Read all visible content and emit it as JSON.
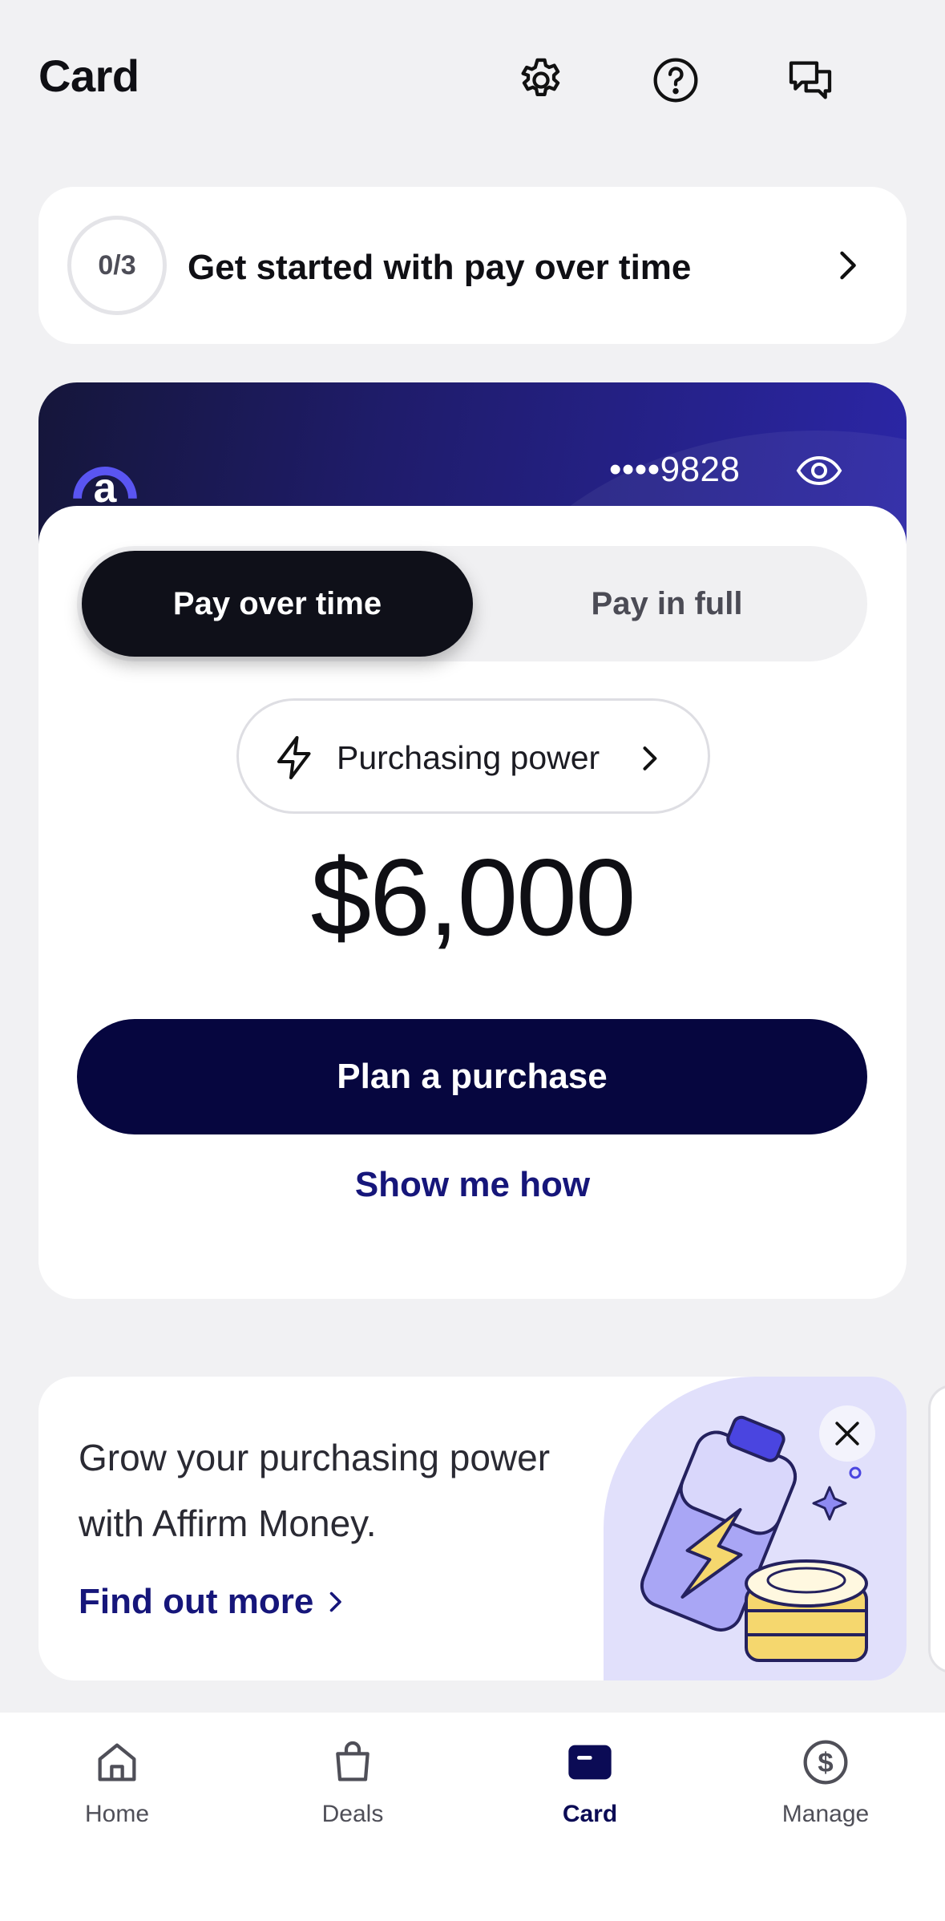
{
  "header": {
    "title": "Card",
    "icons": [
      "gear-icon",
      "help-icon",
      "chat-icon"
    ]
  },
  "onboarding": {
    "progress": "0/3",
    "text": "Get started with pay over time"
  },
  "card": {
    "number_masked": "••••9828",
    "toggle": {
      "active": "Pay over time",
      "inactive": "Pay in full"
    },
    "purchasing_power_label": "Purchasing power",
    "amount": "$6,000",
    "plan_button": "Plan a purchase",
    "show_me_how": "Show me how"
  },
  "promo": {
    "text": "Grow your purchasing power with Affirm Money.",
    "link": "Find out more"
  },
  "tabbar": {
    "items": [
      {
        "label": "Home",
        "icon": "home-icon"
      },
      {
        "label": "Deals",
        "icon": "bag-icon"
      },
      {
        "label": "Card",
        "icon": "card-icon"
      },
      {
        "label": "Manage",
        "icon": "dollar-icon"
      }
    ],
    "active": "Card"
  },
  "colors": {
    "accent_navy": "#06063f",
    "link_blue": "#16167a",
    "card_purple": "#2b26a6",
    "background": "#f1f1f3"
  }
}
